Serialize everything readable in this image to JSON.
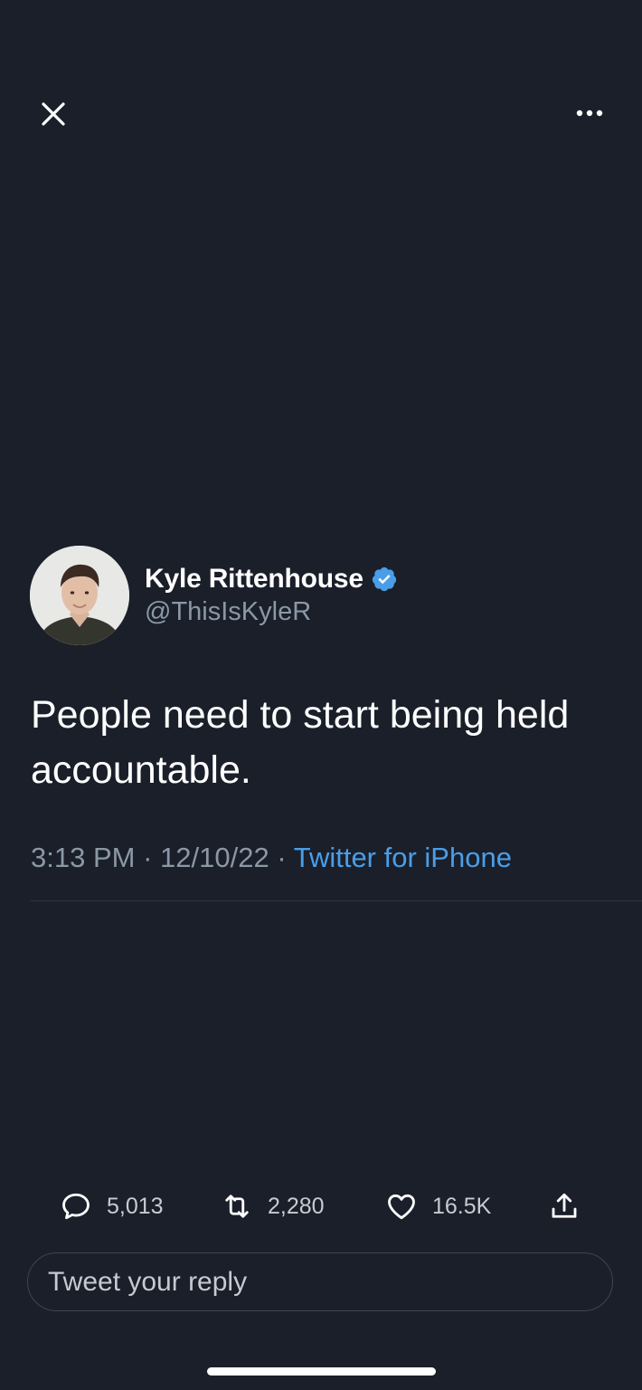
{
  "header": {
    "close_icon": "close-icon",
    "more_icon": "more-horizontal-icon"
  },
  "author": {
    "display_name": "Kyle Rittenhouse",
    "handle": "@ThisIsKyleR",
    "verified": true,
    "verified_color": "#4a9ee8"
  },
  "tweet": {
    "text": "People need to start being held accountable.",
    "time": "3:13 PM",
    "separator": "·",
    "date": "12/10/22",
    "source": "Twitter for iPhone"
  },
  "actions": {
    "replies": "5,013",
    "retweets": "2,280",
    "likes": "16.5K",
    "reply_icon": "reply-icon",
    "retweet_icon": "retweet-icon",
    "like_icon": "heart-icon",
    "share_icon": "share-icon"
  },
  "reply_box": {
    "placeholder": "Tweet your reply"
  },
  "colors": {
    "background": "#1a1f2a",
    "accent": "#4a9ee8",
    "secondary_text": "#8b98a5"
  }
}
